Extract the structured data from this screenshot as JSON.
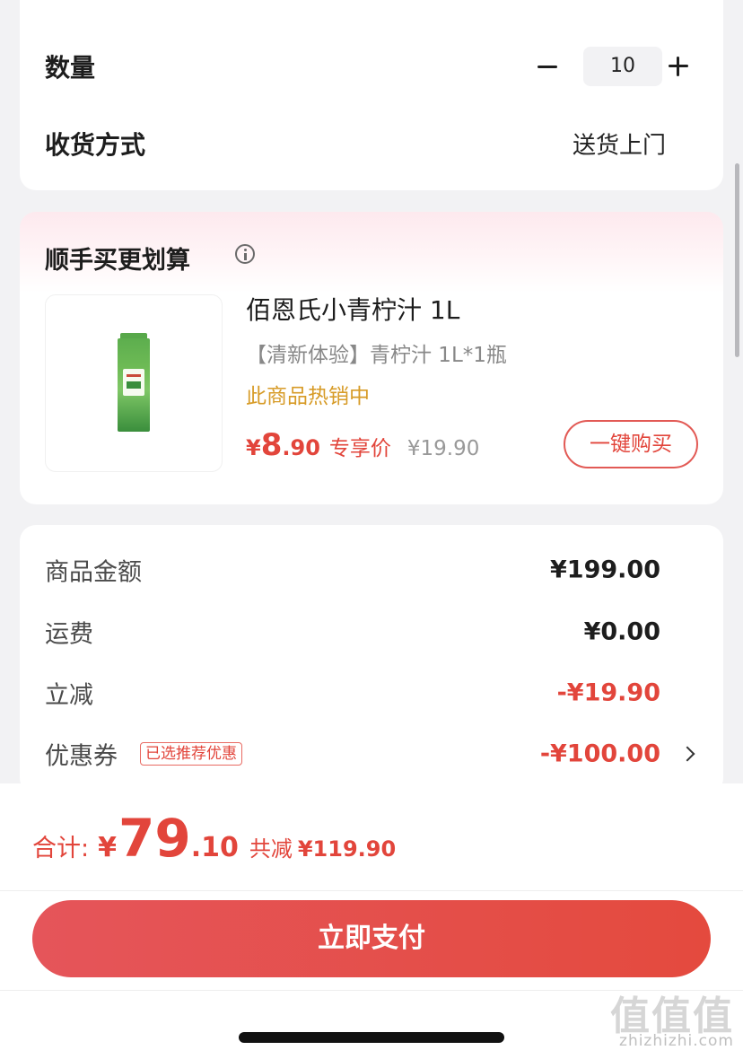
{
  "order_options": {
    "quantity_label": "数量",
    "quantity_value": "10",
    "delivery_label": "收货方式",
    "delivery_value": "送货上门"
  },
  "addon": {
    "title": "顺手买更划算",
    "product": {
      "name": "佰恩氏小青柠汁 1L",
      "spec": "【清新体验】青柠汁 1L*1瓶",
      "hot_tag": "此商品热销中",
      "price_currency": "¥",
      "price_integer": "8",
      "price_decimal": ".90",
      "price_tag": "专享价",
      "original_price": "¥19.90",
      "buy_button": "一键购买"
    }
  },
  "summary": {
    "rows": [
      {
        "label": "商品金额",
        "value": "¥199.00"
      },
      {
        "label": "运费",
        "value": "¥0.00"
      },
      {
        "label": "立减",
        "value": "-¥19.90"
      },
      {
        "label": "优惠券",
        "badge": "已选推荐优惠",
        "value": "-¥100.00"
      }
    ]
  },
  "checkout": {
    "total_label": "合计:",
    "currency": "¥",
    "total_integer": "79",
    "total_decimal": ".10",
    "saved_label": "共减",
    "saved_value": "¥119.90",
    "pay_button": "立即支付"
  },
  "watermark": {
    "logo": "值值值",
    "url": "zhizhizhi.com"
  },
  "colors": {
    "accent_red": "#e2453b",
    "hot_orange": "#d79b27",
    "background": "#f2f2f4"
  }
}
